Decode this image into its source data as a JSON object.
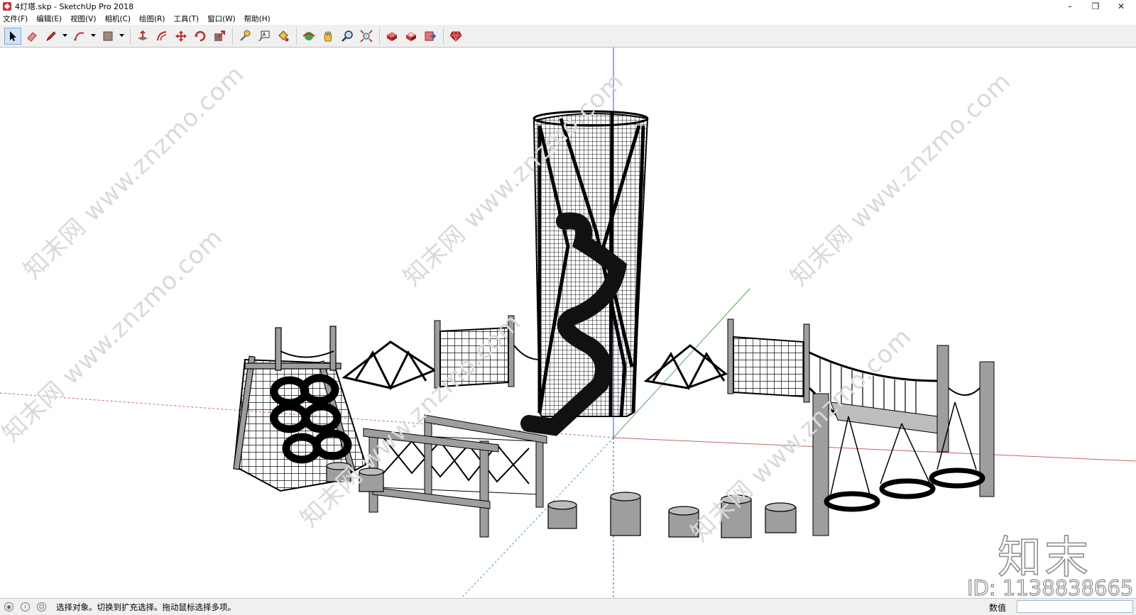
{
  "window": {
    "title": "4灯塔.skp - SketchUp Pro 2018",
    "controls": [
      "–",
      "❐",
      "✕"
    ]
  },
  "menus": [
    "文件(F)",
    "编辑(E)",
    "视图(V)",
    "相机(C)",
    "绘图(R)",
    "工具(T)",
    "窗口(W)",
    "帮助(H)"
  ],
  "toolbar": {
    "tools": [
      {
        "name": "select-icon",
        "active": true
      },
      {
        "name": "eraser-icon"
      },
      {
        "name": "pencil-icon"
      },
      {
        "name": "arc-icon"
      },
      {
        "name": "rectangle-icon"
      },
      {
        "name": "push-pull-icon"
      },
      {
        "name": "offset-icon"
      },
      {
        "name": "move-icon"
      },
      {
        "name": "rotate-icon"
      },
      {
        "name": "scale-icon"
      },
      {
        "name": "tape-measure-icon"
      },
      {
        "name": "text-icon"
      },
      {
        "name": "paint-bucket-icon"
      },
      {
        "name": "orbit-icon"
      },
      {
        "name": "pan-icon"
      },
      {
        "name": "zoom-icon"
      },
      {
        "name": "zoom-extents-icon"
      },
      {
        "name": "warehouse-icon"
      },
      {
        "name": "extension-warehouse-icon"
      },
      {
        "name": "send-to-layout-icon"
      },
      {
        "name": "ruby-icon"
      }
    ]
  },
  "watermarks": [
    "知末网 www.znzmo.com",
    "知末网 www.znzmo.com",
    "知末网 www.znzmo.com",
    "知末网 www.znzmo.com",
    "知末网 www.znzmo.com",
    "知末网 www.znzmo.com"
  ],
  "brand": {
    "logo": "知末",
    "id_text": "ID: 1138838665"
  },
  "status": {
    "message": "选择对象。切换到扩充选择。拖动鼠标选择多项。",
    "value_label": "数值",
    "value": ""
  },
  "colors": {
    "toolbar_bg": "#f0f0f0",
    "axis_red": "#c86464",
    "axis_green": "#4caf50",
    "axis_blue": "#3f51b5"
  }
}
